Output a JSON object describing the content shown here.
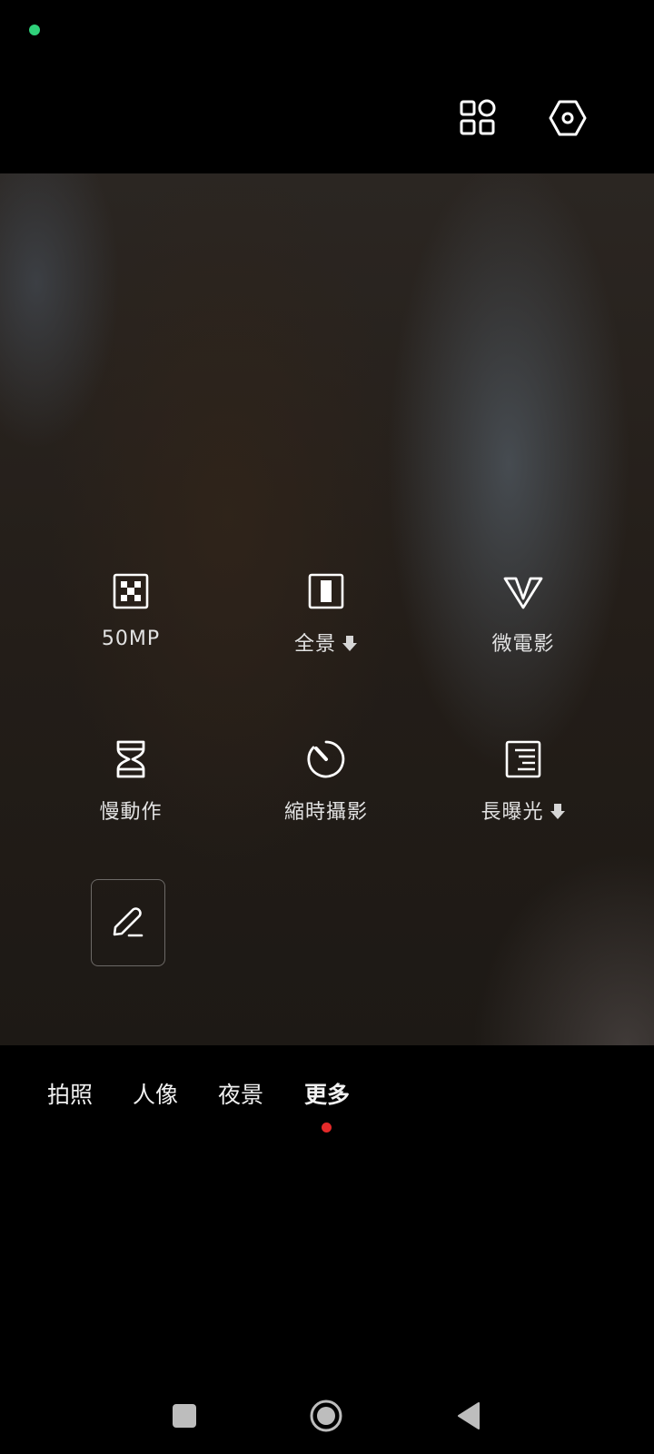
{
  "status_bar": {
    "indicator_color": "#2fd17a"
  },
  "top_bar": {
    "grid_icon": "grid-icon",
    "settings_icon": "settings-hexagon-icon"
  },
  "modes": {
    "items": [
      {
        "label": "50MP",
        "icon": "50mp-icon",
        "download": false
      },
      {
        "label": "全景",
        "icon": "panorama-icon",
        "download": true
      },
      {
        "label": "微電影",
        "icon": "micro-movie-icon",
        "download": false
      },
      {
        "label": "慢動作",
        "icon": "hourglass-icon",
        "download": false
      },
      {
        "label": "縮時攝影",
        "icon": "timelapse-icon",
        "download": false
      },
      {
        "label": "長曝光",
        "icon": "long-exposure-icon",
        "download": true
      }
    ],
    "edit_icon": "pencil-edit-icon"
  },
  "mode_tabs": {
    "items": [
      "拍照",
      "人像",
      "夜景",
      "更多"
    ],
    "active": "更多",
    "indicator_color": "#e42a2a"
  },
  "nav_bar": {
    "recents_icon": "square-recents-icon",
    "home_icon": "circle-home-icon",
    "back_icon": "triangle-back-icon"
  }
}
